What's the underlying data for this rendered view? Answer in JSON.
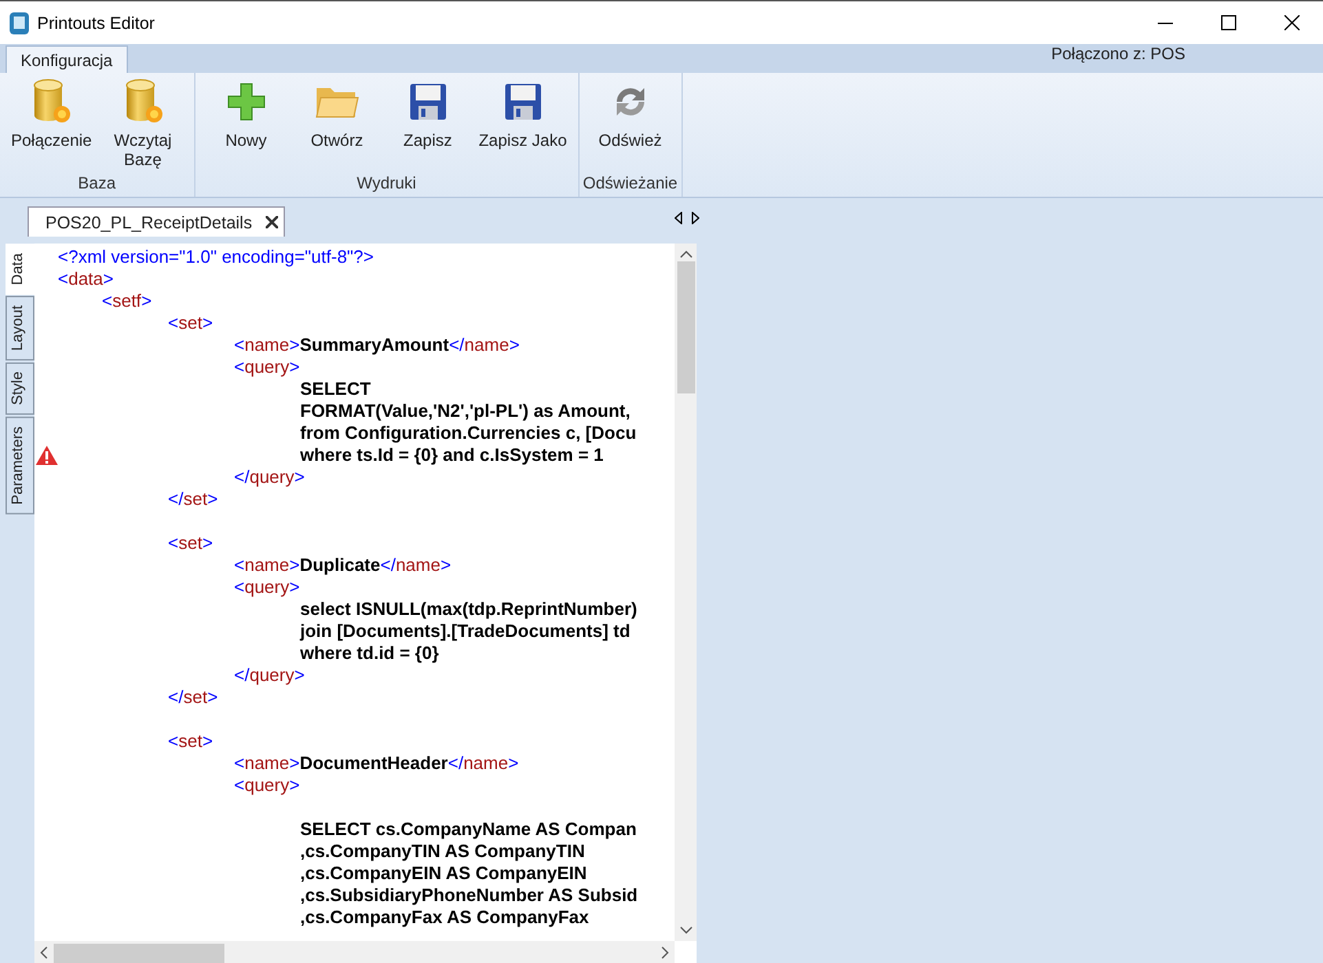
{
  "window": {
    "title": "Printouts Editor"
  },
  "ribbon": {
    "tabs": [
      {
        "label": "Konfiguracja",
        "selected": true
      }
    ],
    "connection": "Połączono z: POS",
    "groups": [
      {
        "label": "Baza",
        "buttons": [
          {
            "label": "Połączenie",
            "kind": "database"
          },
          {
            "label": "Wczytaj\nBazę",
            "kind": "database"
          }
        ]
      },
      {
        "label": "Wydruki",
        "buttons": [
          {
            "label": "Nowy",
            "kind": "plus"
          },
          {
            "label": "Otwórz",
            "kind": "folder"
          },
          {
            "label": "Zapisz",
            "kind": "floppy"
          },
          {
            "label": "Zapisz Jako",
            "kind": "floppy"
          }
        ]
      },
      {
        "label": "Odświeżanie",
        "buttons": [
          {
            "label": "Odśwież",
            "kind": "refresh"
          }
        ]
      }
    ]
  },
  "document_tabs": [
    {
      "label": "POS20_PL_ReceiptDetails",
      "selected": true
    }
  ],
  "side_tabs": [
    {
      "label": "Data",
      "selected": true
    },
    {
      "label": "Layout",
      "selected": false
    },
    {
      "label": "Style",
      "selected": false
    },
    {
      "label": "Parameters",
      "selected": false
    }
  ],
  "editor": {
    "nodes": [
      {
        "kind": "decl",
        "text": "<?xml version=\"1.0\" encoding=\"utf-8\"?>"
      },
      {
        "kind": "tag",
        "text": "<data>",
        "children": [
          {
            "kind": "tag",
            "text": "<setf>",
            "children": [
              {
                "kind": "tag",
                "text": "<set>",
                "children": [
                  {
                    "kind": "tag",
                    "text": "<name>SummaryAmount</name>"
                  },
                  {
                    "kind": "tag",
                    "text": "<query>",
                    "children": [
                      {
                        "kind": "text",
                        "text": "SELECT",
                        "warning": false
                      },
                      {
                        "kind": "text",
                        "text": "FORMAT(Value,'N2','pl-PL') as Amount,",
                        "warning": false
                      },
                      {
                        "kind": "text",
                        "text": "from Configuration.Currencies c, [Docu",
                        "warning": false
                      },
                      {
                        "kind": "text",
                        "text": "where ts.Id = {0} and c.IsSystem = 1",
                        "warning": true
                      }
                    ]
                  },
                  {
                    "kind": "tag",
                    "text": "</query>"
                  }
                ]
              },
              {
                "kind": "tag",
                "text": "</set>"
              },
              {
                "kind": "blank"
              },
              {
                "kind": "tag",
                "text": "<set>",
                "children": [
                  {
                    "kind": "tag",
                    "text": "<name>Duplicate</name>"
                  },
                  {
                    "kind": "tag",
                    "text": "<query>",
                    "children": [
                      {
                        "kind": "text",
                        "text": "select ISNULL(max(tdp.ReprintNumber)",
                        "warning": false
                      },
                      {
                        "kind": "text",
                        "text": "join [Documents].[TradeDocuments] td",
                        "warning": false
                      },
                      {
                        "kind": "text",
                        "text": "where td.id = {0}",
                        "warning": false
                      }
                    ]
                  },
                  {
                    "kind": "tag",
                    "text": "</query>"
                  }
                ]
              },
              {
                "kind": "tag",
                "text": "</set>"
              },
              {
                "kind": "blank"
              },
              {
                "kind": "tag",
                "text": "<set>",
                "children": [
                  {
                    "kind": "tag",
                    "text": "<name>DocumentHeader</name>"
                  },
                  {
                    "kind": "tag",
                    "text": "<query>",
                    "children": [
                      {
                        "kind": "blank"
                      },
                      {
                        "kind": "text",
                        "text": "SELECT cs.CompanyName AS Compan",
                        "warning": false
                      },
                      {
                        "kind": "text",
                        "text": ",cs.CompanyTIN AS CompanyTIN",
                        "warning": false
                      },
                      {
                        "kind": "text",
                        "text": ",cs.CompanyEIN AS CompanyEIN",
                        "warning": false
                      },
                      {
                        "kind": "text",
                        "text": ",cs.SubsidiaryPhoneNumber AS Subsid",
                        "warning": false
                      },
                      {
                        "kind": "text",
                        "text": ",cs.CompanyFax AS CompanyFax",
                        "warning": false
                      }
                    ]
                  }
                ]
              }
            ]
          }
        ]
      }
    ]
  }
}
